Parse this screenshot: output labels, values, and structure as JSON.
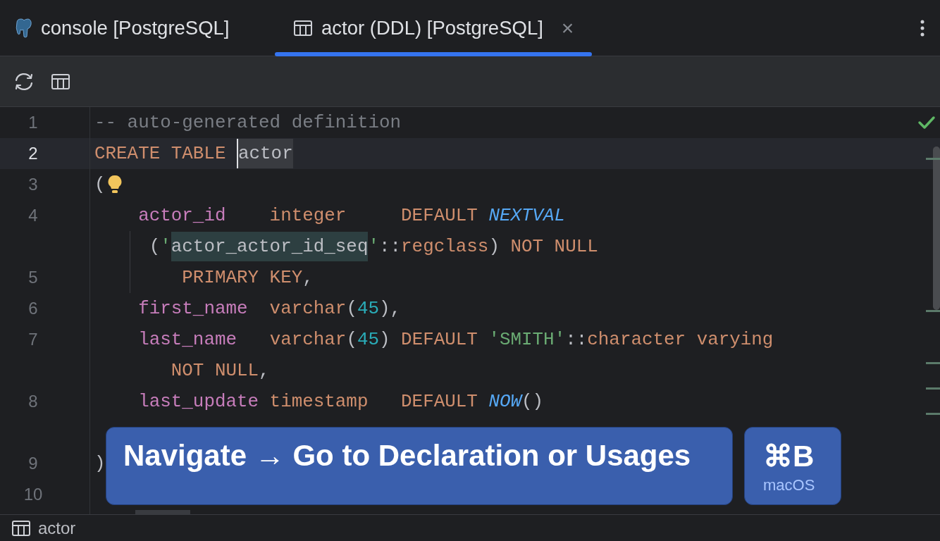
{
  "tabs": [
    {
      "label": "console [PostgreSQL]",
      "selected": false
    },
    {
      "label": "actor (DDL) [PostgreSQL]",
      "selected": true,
      "close": "×"
    }
  ],
  "editor": {
    "inspection_ok": true,
    "lines": [
      {
        "number": "1",
        "current": false,
        "tokens": [
          {
            "text": "-- auto-generated definition",
            "kind": "comment"
          }
        ]
      },
      {
        "number": "2",
        "current": true,
        "tokens": [
          {
            "text": "CREATE TABLE ",
            "kind": "keyword"
          },
          {
            "text": "actor",
            "kind": "target"
          }
        ]
      },
      {
        "number": "3",
        "current": false,
        "bulb": true,
        "tokens": [
          {
            "text": "(",
            "kind": "plain"
          }
        ]
      },
      {
        "number": "4",
        "current": false,
        "tokens": [
          {
            "text": "    actor_id    ",
            "kind": "column"
          },
          {
            "text": "integer     ",
            "kind": "keyword"
          },
          {
            "text": "DEFAULT ",
            "kind": "keyword"
          },
          {
            "text": "NEXTVAL",
            "kind": "function"
          }
        ]
      },
      {
        "current": false,
        "guide": true,
        "tokens": [
          {
            "text": "     (",
            "kind": "plain"
          },
          {
            "text": "'",
            "kind": "string"
          },
          {
            "text": "actor_actor_id_seq",
            "kind": "highlight"
          },
          {
            "text": "'",
            "kind": "string"
          },
          {
            "text": "::",
            "kind": "plain"
          },
          {
            "text": "regclass",
            "kind": "keyword"
          },
          {
            "text": ")",
            "kind": "plain"
          },
          {
            "text": " NOT NULL",
            "kind": "keyword"
          }
        ]
      },
      {
        "number": "5",
        "current": false,
        "guide": true,
        "tokens": [
          {
            "text": "        PRIMARY KEY",
            "kind": "keyword"
          },
          {
            "text": ",",
            "kind": "plain"
          }
        ]
      },
      {
        "number": "6",
        "current": false,
        "tokens": [
          {
            "text": "    first_name  ",
            "kind": "column"
          },
          {
            "text": "varchar",
            "kind": "keyword"
          },
          {
            "text": "(",
            "kind": "plain"
          },
          {
            "text": "45",
            "kind": "number"
          },
          {
            "text": "),",
            "kind": "plain"
          }
        ]
      },
      {
        "number": "7",
        "current": false,
        "tokens": [
          {
            "text": "    last_name   ",
            "kind": "column"
          },
          {
            "text": "varchar",
            "kind": "keyword"
          },
          {
            "text": "(",
            "kind": "plain"
          },
          {
            "text": "45",
            "kind": "number"
          },
          {
            "text": ") ",
            "kind": "plain"
          },
          {
            "text": "DEFAULT ",
            "kind": "keyword"
          },
          {
            "text": "'SMITH'",
            "kind": "string"
          },
          {
            "text": "::",
            "kind": "plain"
          },
          {
            "text": "character varying",
            "kind": "keyword"
          }
        ]
      },
      {
        "current": false,
        "tokens": [
          {
            "text": "       NOT NULL",
            "kind": "keyword"
          },
          {
            "text": ",",
            "kind": "plain"
          }
        ]
      },
      {
        "number": "8",
        "current": false,
        "tokens": [
          {
            "text": "    last_update ",
            "kind": "column"
          },
          {
            "text": "timestamp   ",
            "kind": "keyword"
          },
          {
            "text": "DEFAULT ",
            "kind": "keyword"
          },
          {
            "text": "NOW",
            "kind": "function"
          },
          {
            "text": "()",
            "kind": "plain"
          }
        ]
      },
      {
        "current": false
      },
      {
        "number": "9",
        "current": false,
        "tokens": [
          {
            "text": ")",
            "kind": "plain"
          }
        ]
      },
      {
        "number": "10",
        "current": false
      }
    ]
  },
  "hint": {
    "action": "Navigate → Go to Declaration or Usages",
    "shortcut": "⌘B",
    "platform": "macOS"
  },
  "status_bar": {
    "breadcrumb": "actor"
  }
}
